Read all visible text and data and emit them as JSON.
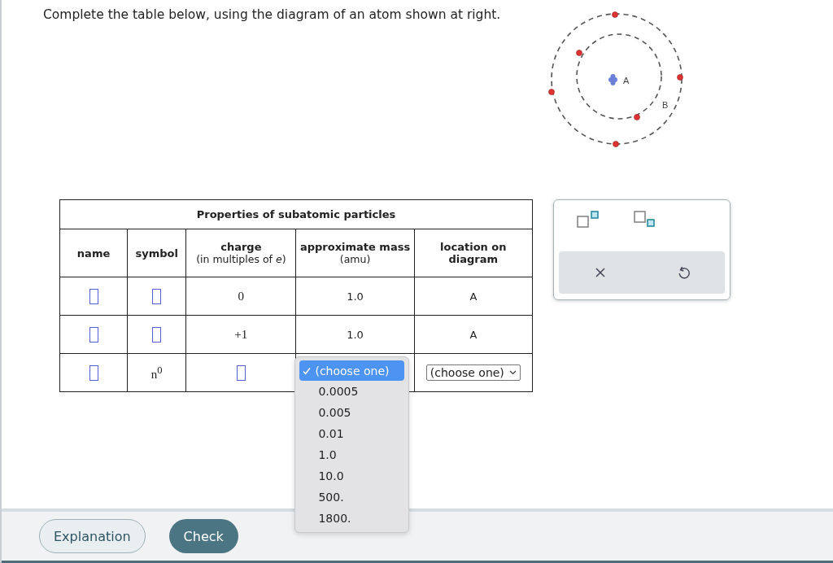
{
  "prompt": "Complete the table below, using the diagram of an atom shown at right.",
  "diagram": {
    "labels": [
      "A",
      "B"
    ]
  },
  "table": {
    "title": "Properties of subatomic particles",
    "columns": [
      {
        "label": "name"
      },
      {
        "label": "symbol"
      },
      {
        "label": "charge",
        "note": "(in multiples of *e*)"
      },
      {
        "label": "approximate mass",
        "note": "(amu)"
      },
      {
        "label": "location on diagram"
      }
    ],
    "rows": [
      [
        {
          "kind": "blank"
        },
        {
          "kind": "blank"
        },
        {
          "kind": "serif",
          "text": "0"
        },
        {
          "kind": "text",
          "text": "1.0"
        },
        {
          "kind": "text",
          "text": "A"
        }
      ],
      [
        {
          "kind": "blank"
        },
        {
          "kind": "blank"
        },
        {
          "kind": "serif",
          "text": "+1"
        },
        {
          "kind": "text",
          "text": "1.0"
        },
        {
          "kind": "text",
          "text": "A"
        }
      ],
      [
        {
          "kind": "blank"
        },
        {
          "kind": "serif",
          "text": "n$^{0}$"
        },
        {
          "kind": "blank"
        },
        {
          "kind": "dropdown",
          "options": [
            {
              "label": "(choose one)",
              "selected": true
            },
            {
              "label": "0.0005",
              "selected": false
            },
            {
              "label": "0.005",
              "selected": false
            },
            {
              "label": "0.01",
              "selected": false
            },
            {
              "label": "1.0",
              "selected": false
            },
            {
              "label": "10.0",
              "selected": false
            },
            {
              "label": "500.",
              "selected": false
            },
            {
              "label": "1800.",
              "selected": false
            }
          ]
        },
        {
          "kind": "select",
          "value": "(choose one)"
        }
      ]
    ]
  },
  "buttons": [
    {
      "label": "Explanation",
      "kind": "secondary"
    },
    {
      "label": "Check",
      "kind": "primary"
    }
  ]
}
